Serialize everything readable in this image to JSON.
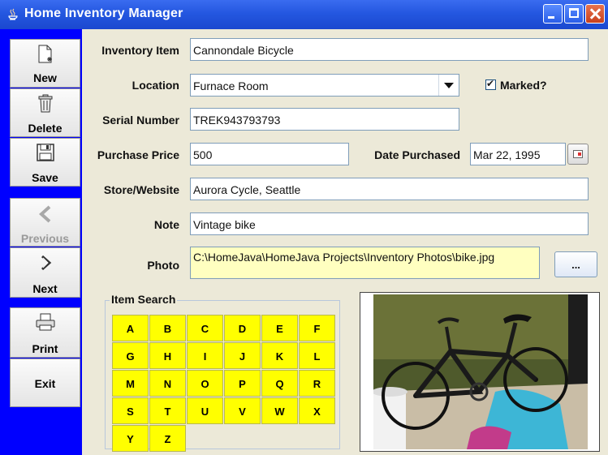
{
  "window": {
    "title": "Home Inventory Manager"
  },
  "toolbar": {
    "new_label": "New",
    "delete_label": "Delete",
    "save_label": "Save",
    "previous_label": "Previous",
    "next_label": "Next",
    "print_label": "Print",
    "exit_label": "Exit"
  },
  "form": {
    "inventory_item_label": "Inventory Item",
    "inventory_item_value": "Cannondale Bicycle",
    "location_label": "Location",
    "location_value": "Furnace Room",
    "marked_label": "Marked?",
    "marked_checked": true,
    "serial_number_label": "Serial Number",
    "serial_number_value": "TREK943793793",
    "purchase_price_label": "Purchase Price",
    "purchase_price_value": "500",
    "date_purchased_label": "Date Purchased",
    "date_purchased_value": "Mar 22, 1995",
    "store_label": "Store/Website",
    "store_value": "Aurora Cycle, Seattle",
    "note_label": "Note",
    "note_value": "Vintage bike",
    "photo_label": "Photo",
    "photo_path": "C:\\HomeJava\\HomeJava Projects\\Inventory Photos\\bike.jpg",
    "browse_label": "..."
  },
  "item_search": {
    "title": "Item Search",
    "letters": [
      "A",
      "B",
      "C",
      "D",
      "E",
      "F",
      "G",
      "H",
      "I",
      "J",
      "K",
      "L",
      "M",
      "N",
      "O",
      "P",
      "Q",
      "R",
      "S",
      "T",
      "U",
      "V",
      "W",
      "X",
      "Y",
      "Z"
    ]
  },
  "colors": {
    "toolbar_bg": "#0000ff",
    "search_key_bg": "#ffff00",
    "photo_field_bg": "#ffffc0"
  }
}
